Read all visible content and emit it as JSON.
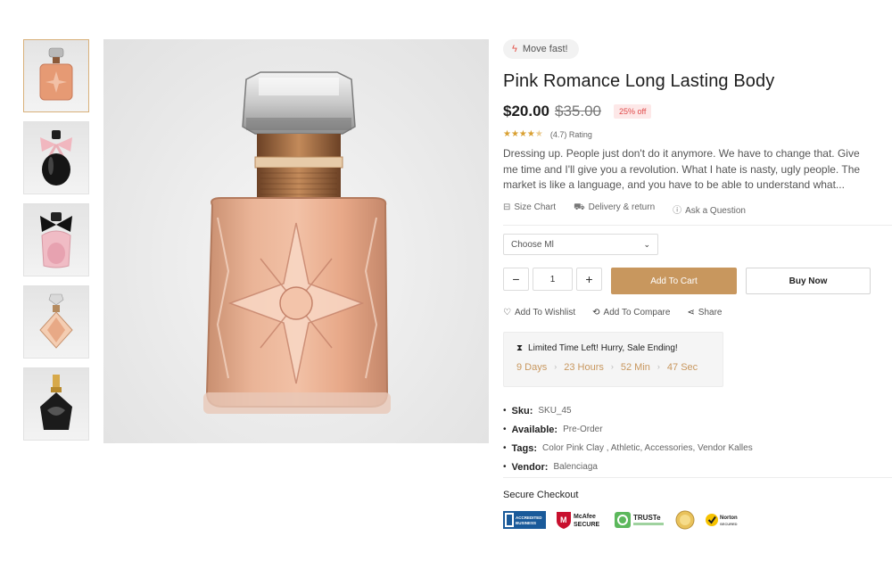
{
  "badge": {
    "icon": "bolt-icon",
    "text": "Move fast!"
  },
  "product": {
    "title": "Pink Romance Long Lasting Body",
    "price": "$20.00",
    "old_price": "$35.00",
    "discount": "25% off",
    "rating_stars": 4.7,
    "rating_text": "(4.7) Rating",
    "description": "Dressing up. People just don't do it anymore. We have to change that. Give me time and I'll give you a revolution. What I hate is nasty, ugly people. The market is like a language, and you have to be able to understand what..."
  },
  "links": {
    "size_chart": "Size Chart",
    "delivery": "Delivery & return",
    "ask": "Ask a Question"
  },
  "variant_select": {
    "value": "Choose Ml"
  },
  "quantity": {
    "minus": "−",
    "value": "1",
    "plus": "+"
  },
  "buttons": {
    "add_to_cart": "Add To Cart",
    "buy_now": "Buy Now"
  },
  "actions": {
    "wishlist": "Add To Wishlist",
    "compare": "Add To Compare",
    "share": "Share"
  },
  "countdown": {
    "title": "Limited Time Left! Hurry, Sale Ending!",
    "days": "9 Days",
    "hours": "23 Hours",
    "minutes": "52 Min",
    "seconds": "47 Sec"
  },
  "meta": {
    "sku_label": "Sku:",
    "sku": "SKU_45",
    "available_label": "Available:",
    "available": "Pre-Order",
    "tags_label": "Tags:",
    "tags": "Color Pink Clay , Athletic, Accessories, Vendor Kalles",
    "vendor_label": "Vendor:",
    "vendor": "Balenciaga"
  },
  "secure": {
    "title": "Secure Checkout",
    "badges": {
      "bbb_line1": "ACCREDITED",
      "bbb_line2": "BUSINESS",
      "mcafee_line1": "McAfee",
      "mcafee_line2": "SECURE",
      "truste": "TRUSTe",
      "norton_line1": "Norton",
      "norton_line2": "SECURED"
    }
  },
  "colors": {
    "accent": "#c8975e",
    "discount": "#e04b4b",
    "stars": "#d9a032"
  },
  "gallery": {
    "thumbnails": [
      "thumb-perfume-amber",
      "thumb-perfume-black-pink-bow",
      "thumb-perfume-pink-black-bow",
      "thumb-perfume-diamond",
      "thumb-perfume-black-gold"
    ]
  }
}
